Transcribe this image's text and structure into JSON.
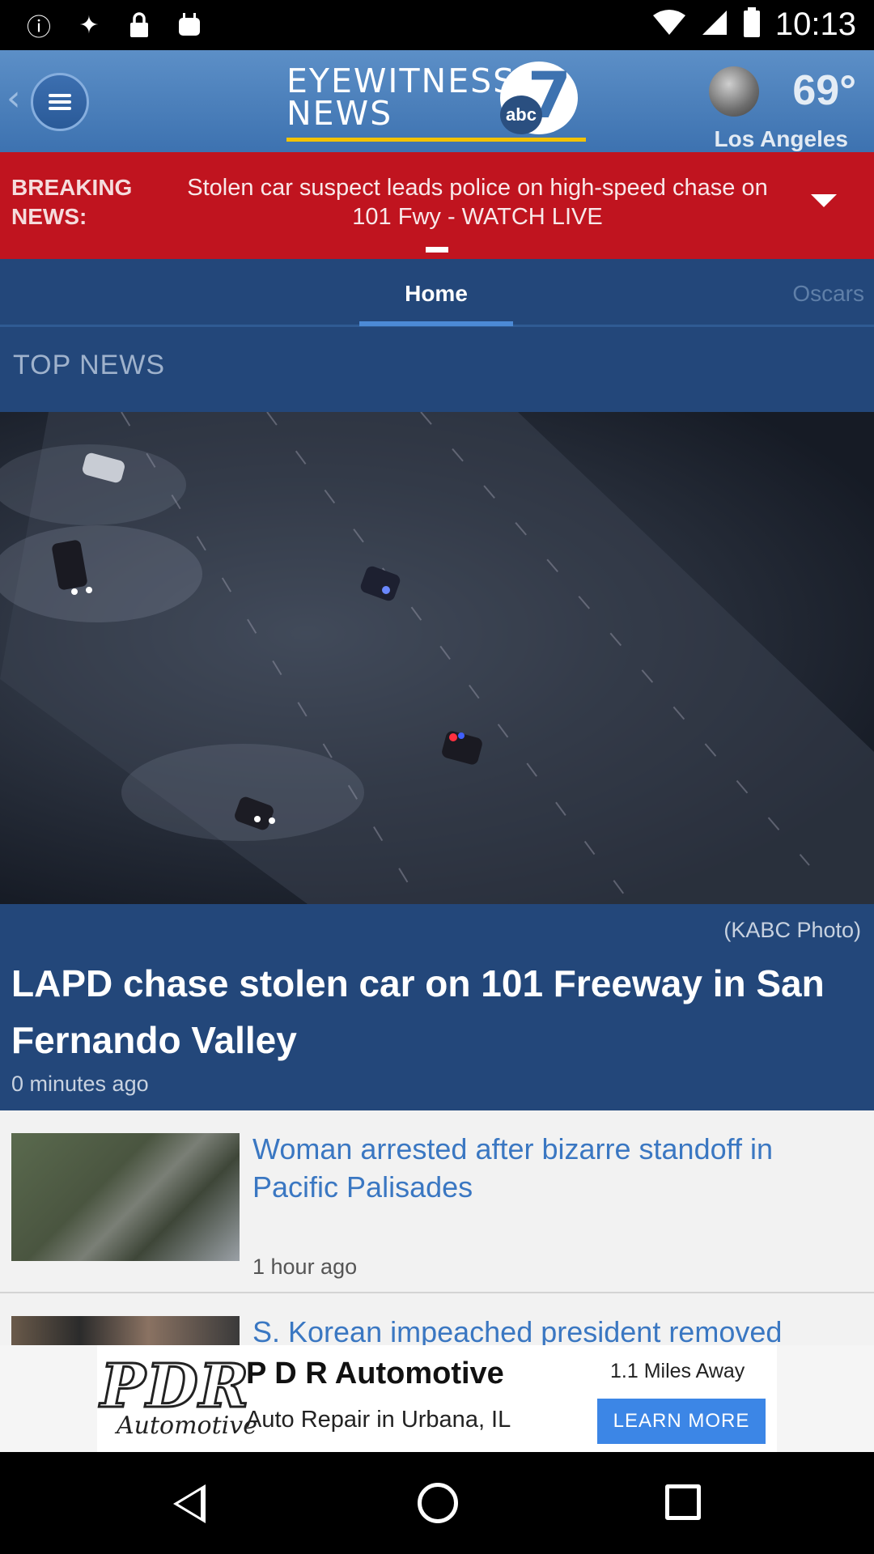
{
  "status_bar": {
    "time": "10:13",
    "icons": [
      "alert-icon",
      "satellite-icon",
      "lock-icon",
      "android-debug-icon"
    ]
  },
  "header": {
    "logo_line1": "EYEWITNESS",
    "logo_line2": "NEWS",
    "logo_abc": "abc",
    "logo_number": "7",
    "temperature": "69°",
    "city": "Los Angeles"
  },
  "breaking": {
    "label_line1": "BREAKING",
    "label_line2": "NEWS:",
    "text": "Stolen car suspect leads police on high-speed chase on 101 Fwy - WATCH LIVE"
  },
  "tabs": [
    {
      "label": "Home",
      "active": true
    },
    {
      "label": "Oscars",
      "active": false
    }
  ],
  "top_news": {
    "section_title": "TOP NEWS",
    "photo_credit": "(KABC Photo)",
    "headline": "LAPD chase stolen car on 101 Freeway in San Fernando Valley",
    "time": "0 minutes ago"
  },
  "stories": [
    {
      "title": "Woman arrested after bizarre standoff in Pacific Palisades",
      "time": "1 hour ago"
    },
    {
      "title": "S. Korean impeached president removed",
      "time": ""
    }
  ],
  "ad": {
    "logo_text": "PDR",
    "logo_sub": "Automotive",
    "name": "P D R Automotive",
    "subtitle": "Auto Repair in Urbana, IL",
    "distance": "1.1 Miles Away",
    "cta": "LEARN MORE"
  },
  "colors": {
    "header": "#3d72b0",
    "breaking": "#c0141f",
    "content_bg": "#23477a",
    "link": "#3a77c2",
    "cta": "#3c86e6"
  }
}
